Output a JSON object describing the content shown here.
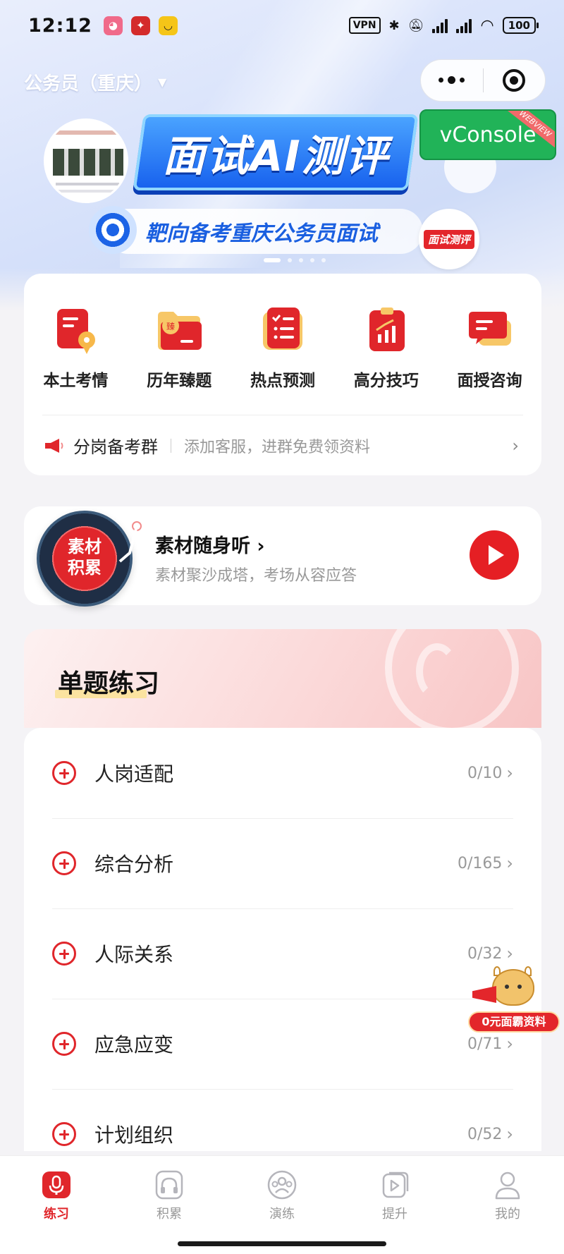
{
  "status_bar": {
    "time": "12:12",
    "vpn": "VPN",
    "battery": "100"
  },
  "header": {
    "city_select": "公务员（重庆）",
    "capsule_more": "more-dots-icon",
    "capsule_close": "target-close-icon"
  },
  "banner": {
    "title": "面试AI测评",
    "subtitle": "靶向备考重庆公务员面试",
    "badge": "面试测评",
    "slide_count": 5,
    "active_slide": 1
  },
  "vconsole": {
    "label": "vConsole",
    "ribbon": "WEBVIEW"
  },
  "quick_entries": [
    {
      "label": "本土考情",
      "icon": "document-location-icon"
    },
    {
      "label": "历年臻题",
      "icon": "folder-icon"
    },
    {
      "label": "热点预测",
      "icon": "checklist-icon"
    },
    {
      "label": "高分技巧",
      "icon": "chart-clipboard-icon"
    },
    {
      "label": "面授咨询",
      "icon": "chat-bubble-icon"
    }
  ],
  "notice": {
    "title": "分岗备考群",
    "desc": "添加客服，进群免费领资料",
    "arrow": "›"
  },
  "audio_card": {
    "disc_line1": "素材",
    "disc_line2": "积累",
    "title": "素材随身听 ›",
    "desc": "素材聚沙成塔，考场从容应答"
  },
  "practice": {
    "title": "单题练习",
    "items": [
      {
        "name": "人岗适配",
        "count": "0/10"
      },
      {
        "name": "综合分析",
        "count": "0/165"
      },
      {
        "name": "人际关系",
        "count": "0/32"
      },
      {
        "name": "应急应变",
        "count": "0/71"
      },
      {
        "name": "计划组织",
        "count": "0/52"
      }
    ]
  },
  "mascot": {
    "label": "0元面霸资料"
  },
  "tabbar": [
    {
      "label": "练习",
      "icon": "microphone-icon",
      "active": true
    },
    {
      "label": "积累",
      "icon": "headphones-icon",
      "active": false
    },
    {
      "label": "演练",
      "icon": "group-icon",
      "active": false
    },
    {
      "label": "提升",
      "icon": "video-play-icon",
      "active": false
    },
    {
      "label": "我的",
      "icon": "user-icon",
      "active": false
    }
  ],
  "colors": {
    "brand_red": "#e0262b",
    "banner_blue": "#1862ee",
    "vconsole_green": "#21b358"
  }
}
